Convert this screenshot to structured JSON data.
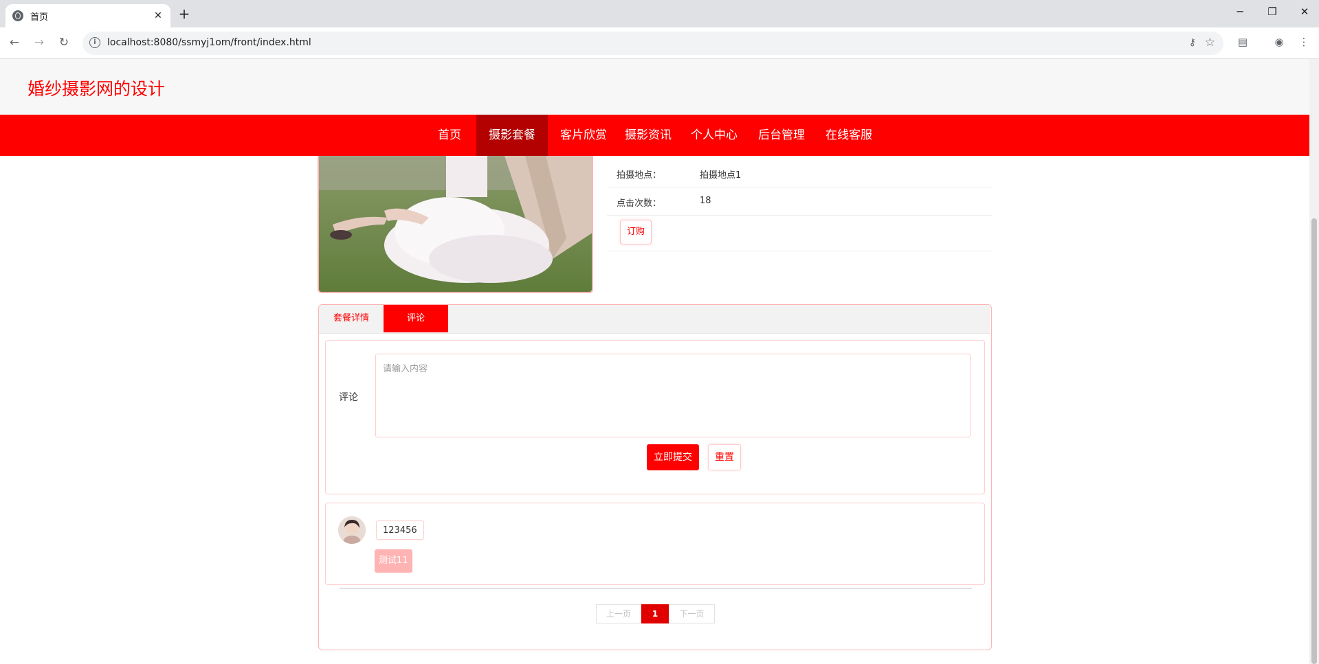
{
  "browser": {
    "tab_title": "首页",
    "url": "localhost:8080/ssmyj1om/front/index.html"
  },
  "site": {
    "title": "婚纱摄影网的设计"
  },
  "nav": {
    "items": [
      "首页",
      "摄影套餐",
      "客片欣赏",
      "摄影资讯",
      "个人中心",
      "后台管理",
      "在线客服"
    ],
    "active_index": 1
  },
  "package_info": {
    "rows": [
      {
        "label": "拍摄地点：",
        "value": "拍摄地点1"
      },
      {
        "label": "点击次数：",
        "value": "18"
      }
    ],
    "order_label": "订购"
  },
  "detail_tabs": {
    "tabs": [
      "套餐详情",
      "评论"
    ],
    "active_index": 1
  },
  "comment_form": {
    "label": "评论",
    "placeholder": "请输入内容",
    "submit_label": "立即提交",
    "reset_label": "重置"
  },
  "comments": [
    {
      "user": "123456",
      "text": "测试11"
    }
  ],
  "pagination": {
    "prev": "上一页",
    "current": "1",
    "next": "下一页"
  },
  "colors": {
    "brand": "#ff0000",
    "nav_active": "#b30000",
    "border_soft": "#ffcccc"
  }
}
